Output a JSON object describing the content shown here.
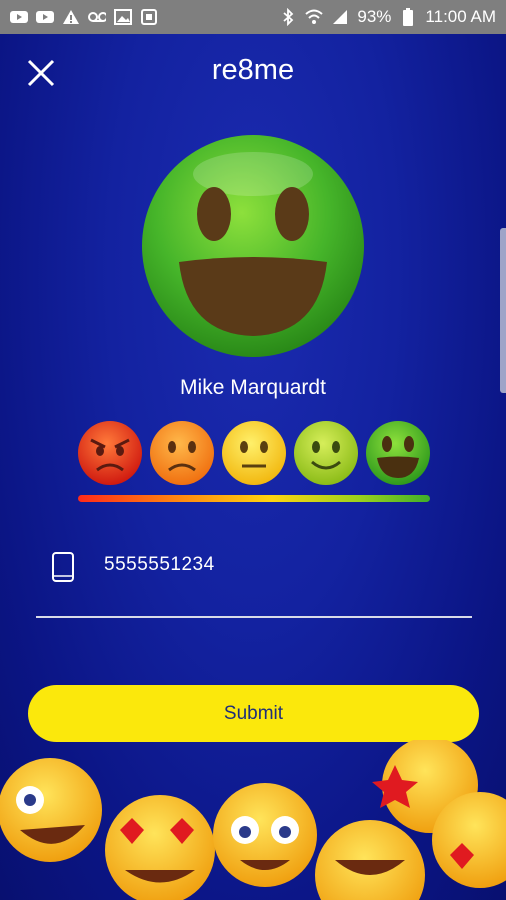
{
  "status_bar": {
    "battery": "93%",
    "time": "11:00 AM"
  },
  "header": {
    "title": "re8me"
  },
  "rated_person": {
    "name": "Mike Marquardt"
  },
  "rating": {
    "options": [
      "very-angry",
      "sad",
      "neutral",
      "happy",
      "very-happy"
    ],
    "selected": "very-happy"
  },
  "phone": {
    "value": "5555551234"
  },
  "submit": {
    "label": "Submit"
  },
  "colors": {
    "background": "#1322a0",
    "button": "#fbe80c",
    "button_text": "#1e2e7a",
    "status_bar": "#7f7f7f"
  }
}
